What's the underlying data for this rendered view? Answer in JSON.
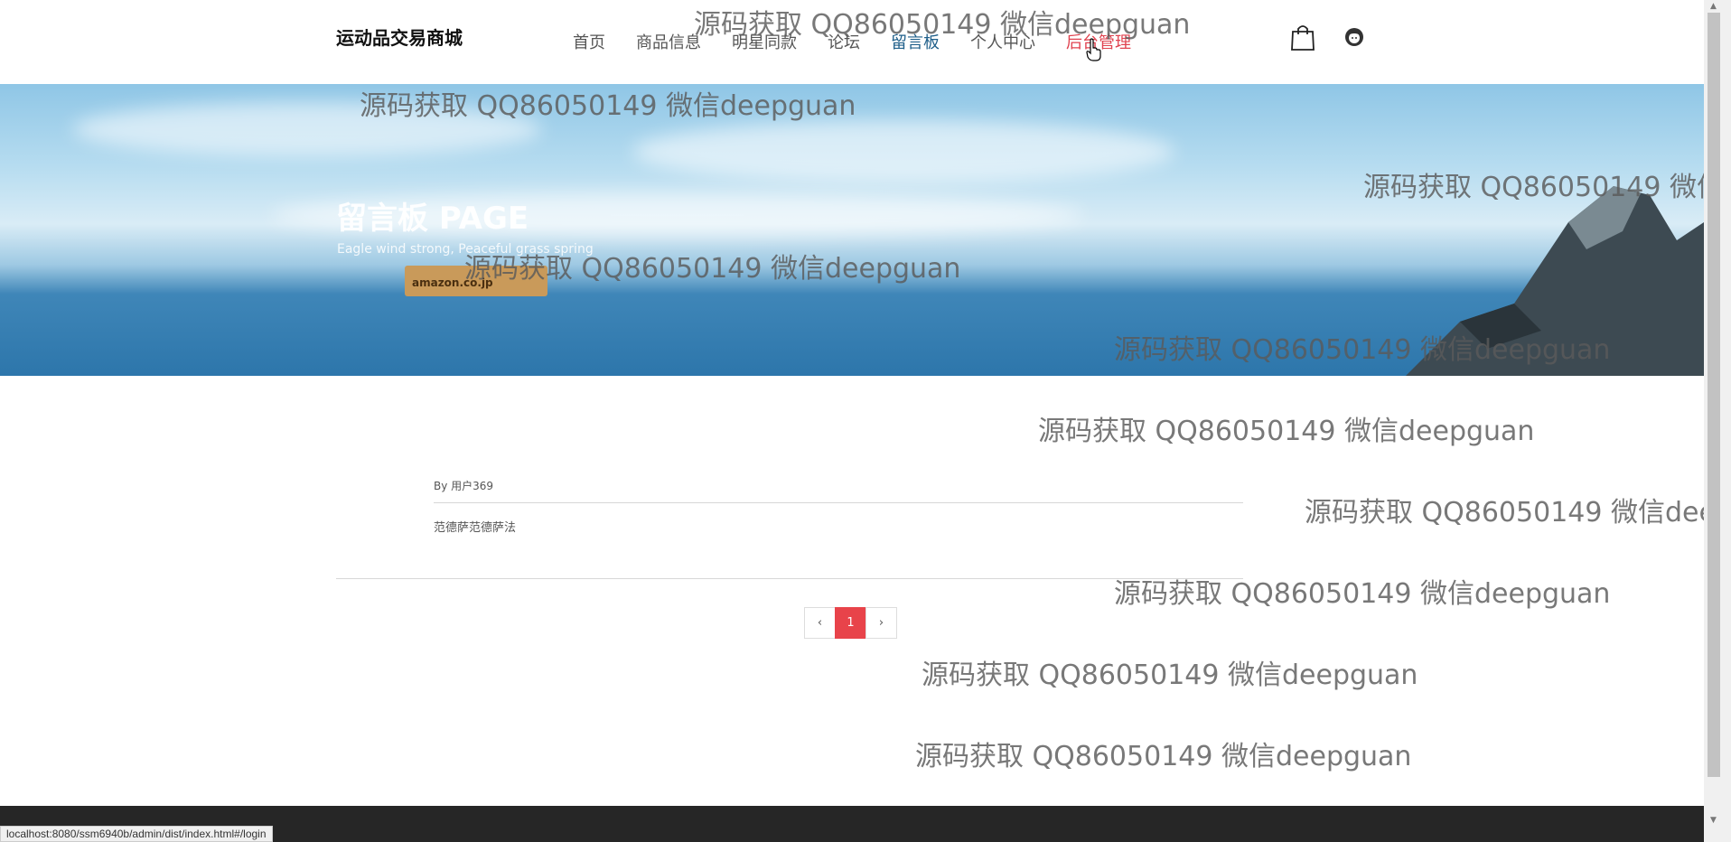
{
  "header": {
    "brand": "运动品交易商城",
    "nav": [
      {
        "label": "首页"
      },
      {
        "label": "商品信息"
      },
      {
        "label": "明星同款"
      },
      {
        "label": "论坛"
      },
      {
        "label": "留言板"
      },
      {
        "label": "个人中心"
      },
      {
        "label": "后台管理"
      }
    ],
    "icons": {
      "cart": "shopping-bag-icon",
      "user": "user-avatar-icon"
    }
  },
  "banner": {
    "title": "留言板 PAGE",
    "subtitle": "Eagle wind strong, Peaceful grass spring",
    "box_label": "amazon.co.jp"
  },
  "post": {
    "author": "By 用户369",
    "content": "范德萨范德萨法"
  },
  "pagination": {
    "prev": "‹",
    "current": "1",
    "next": "›"
  },
  "status_bar": {
    "url": "localhost:8080/ssm6940b/admin/dist/index.html#/login"
  },
  "watermark": {
    "text": "源码获取 QQ86050149 微信deepguan"
  },
  "colors": {
    "active_nav": "#1f5f8a",
    "hover_nav": "#e0424f",
    "page_current": "#e8434a",
    "footer": "#262626"
  }
}
